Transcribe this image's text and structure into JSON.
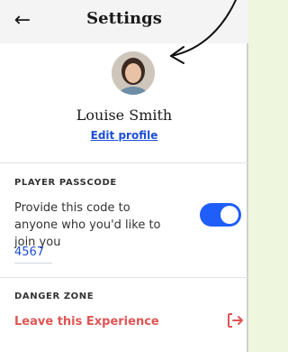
{
  "header": {
    "title": "Settings",
    "back_icon": "back-arrow-icon"
  },
  "profile": {
    "name": "Louise Smith",
    "edit_label": "Edit profile"
  },
  "passcode": {
    "section_label": "PLAYER PASSCODE",
    "description": "Provide this code to anyone who you'd like to join you",
    "code": "4567",
    "toggle_on": true
  },
  "danger": {
    "section_label": "DANGER ZONE",
    "leave_label": "Leave this Experience",
    "leave_icon": "exit-icon"
  },
  "colors": {
    "accent": "#1f5ef8",
    "danger": "#e05555",
    "link": "#1d4ed8"
  }
}
